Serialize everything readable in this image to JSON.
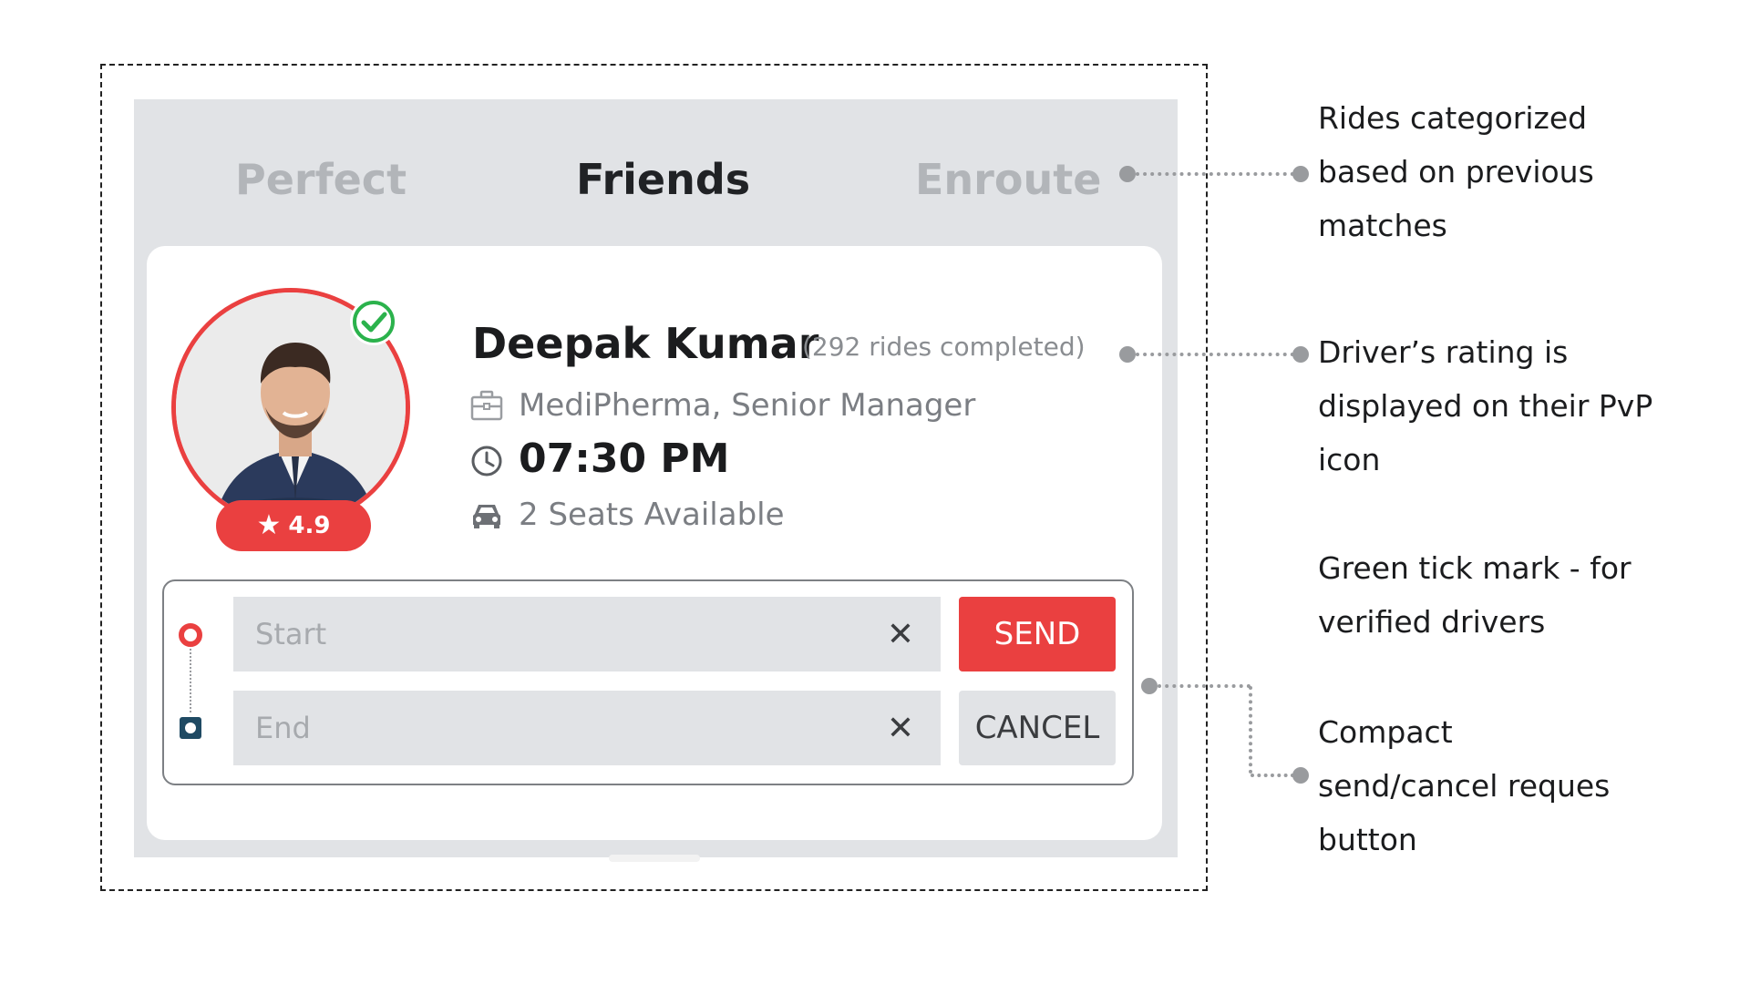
{
  "tabs": {
    "perfect": "Perfect",
    "friends": "Friends",
    "enroute": "Enroute"
  },
  "driver": {
    "name": "Deepak Kumar",
    "rides_completed": "(292 rides completed)",
    "company": "MediPherma, Senior Manager",
    "time": "07:30 PM",
    "seats": "2 Seats Available",
    "rating_star": "★",
    "rating": "4.9",
    "verified_icon": "check-circle-icon"
  },
  "route": {
    "start_placeholder": "Start",
    "end_placeholder": "End",
    "clear_glyph": "✕"
  },
  "buttons": {
    "send": "SEND",
    "cancel": "CANCEL"
  },
  "annotations": {
    "tabs_note": "Rides categorized\nbased on previous\nmatches",
    "rating_note": "Driver’s rating is\ndisplayed on their PvP\nicon",
    "verified_note": "Green tick mark - for\nverified drivers",
    "buttons_note": "Compact\nsend/cancel reques\nbutton"
  },
  "colors": {
    "accent_red": "#ea4040",
    "verified_green": "#2bb24c",
    "panel_gray": "#e1e3e6",
    "end_marker": "#1f4a63"
  }
}
